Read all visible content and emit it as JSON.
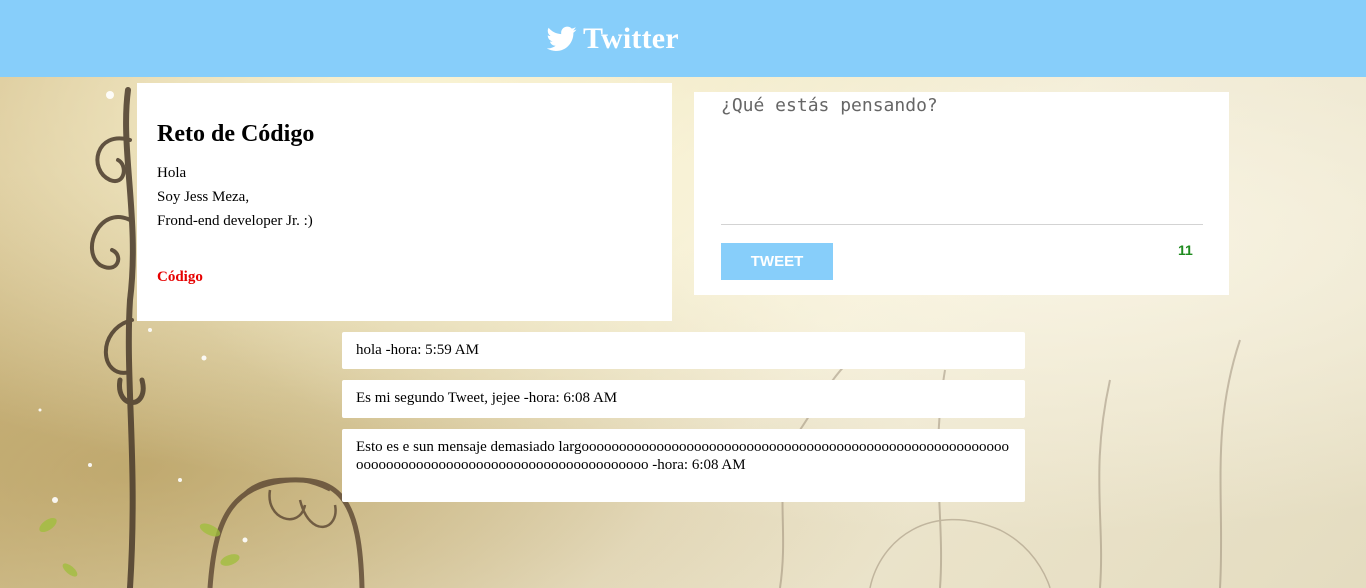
{
  "header": {
    "brand": "Twitter",
    "brand_icon": "twitter-bird-icon",
    "background_color": "#87cefa"
  },
  "profile": {
    "heading": "Reto de Código",
    "bio_lines": [
      "Hola",
      "Soy Jess Meza,",
      "Frond-end developer Jr. :)"
    ],
    "link_label": "Código",
    "link_color": "#e60000"
  },
  "compose": {
    "placeholder": "¿Qué estás pensando?",
    "value": "",
    "button_label": "TWEET",
    "char_counter": "11",
    "counter_color": "#1e8b1e"
  },
  "tweets": [
    {
      "text": "hola -hora: 5:59 AM"
    },
    {
      "text": "Es mi segundo Tweet, jejee -hora: 6:08 AM"
    },
    {
      "text": "Esto es e sun mensaje demasiado largoooooooooooooooooooooooooooooooooooooooooooooooooooooooooooooooooooooooooooooooooooooooooooooooo -hora: 6:08 AM"
    }
  ]
}
